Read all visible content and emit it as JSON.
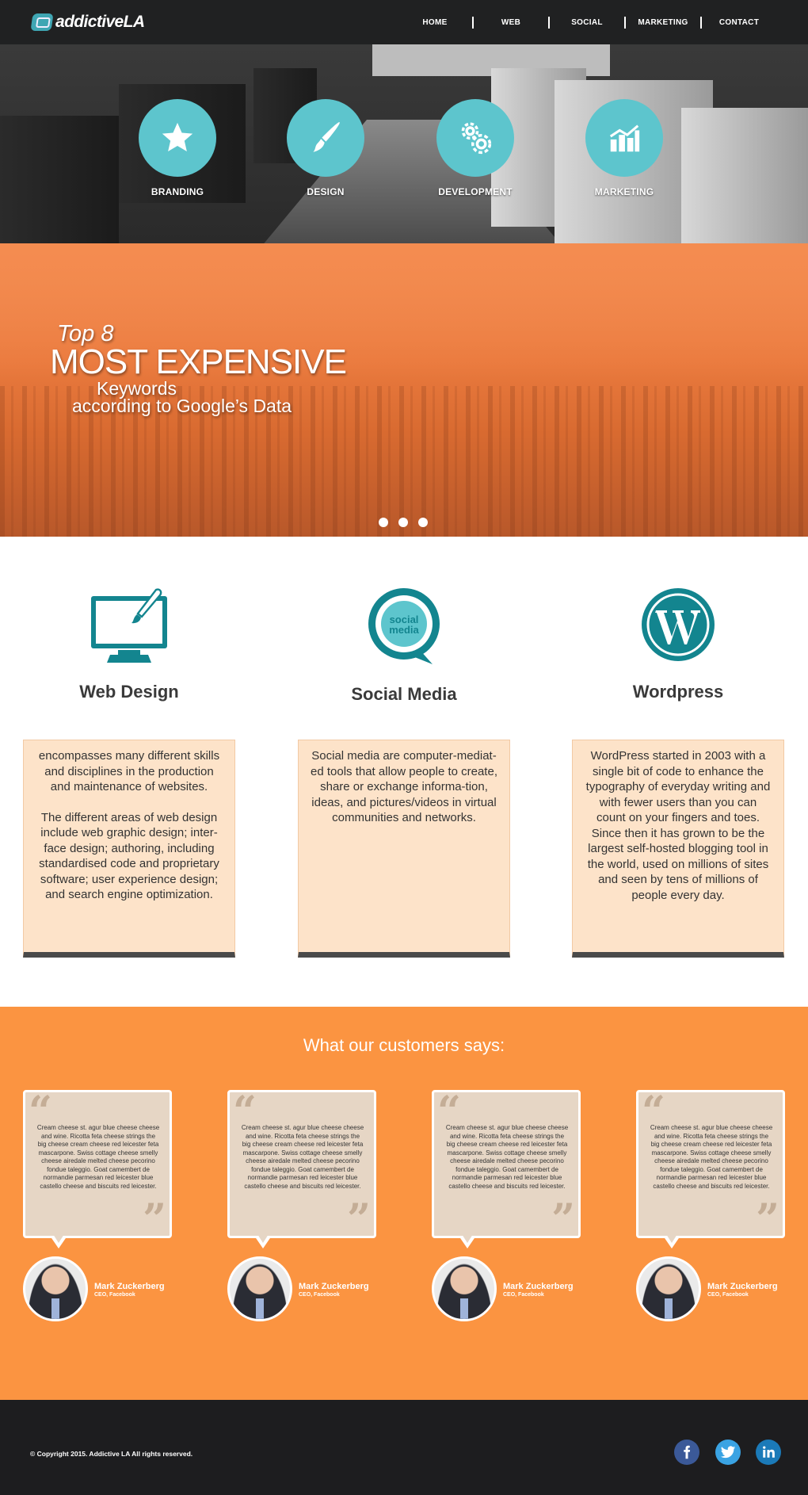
{
  "header": {
    "logo_text": "addictiveLA",
    "nav": [
      "HOME",
      "WEB",
      "SOCIAL",
      "MARKETING",
      "CONTACT"
    ]
  },
  "hero": {
    "services": [
      {
        "label": "BRANDING",
        "icon": "star-icon"
      },
      {
        "label": "DESIGN",
        "icon": "paintbrush-icon"
      },
      {
        "label": "DEVELOPMENT",
        "icon": "gears-icon"
      },
      {
        "label": "MARKETING",
        "icon": "chart-icon"
      }
    ]
  },
  "slider": {
    "line1": "Top 8",
    "line2": "MOST EXPENSIVE",
    "line3": "Keywords",
    "line4": "according to Google’s Data",
    "dots": 3
  },
  "features": [
    {
      "title": "Web Design",
      "icon": "monitor-brush-icon",
      "paragraphs": [
        "encompasses many different skills and disciplines in the production and maintenance of websites.",
        "The different areas of web design include web graphic design; inter-face design; authoring, including standardised code and proprietary software; user experience design; and search engine optimization."
      ]
    },
    {
      "title": "Social Media",
      "icon": "social-media-bubble-icon",
      "icon_text_1": "social",
      "icon_text_2": "media",
      "paragraphs": [
        "Social media are computer-mediat-ed tools that allow people to create, share or exchange informa-tion, ideas, and pictures/videos in virtual communities and networks."
      ]
    },
    {
      "title": "Wordpress",
      "icon": "wordpress-icon",
      "paragraphs": [
        "WordPress started in 2003 with a single bit of code to enhance the typography of everyday writing and with fewer users than you can count on your fingers and toes. Since then it has grown to be the largest self-hosted blogging tool in the world, used on millions of sites and seen by tens of millions of people every day."
      ]
    }
  ],
  "testimonials": {
    "heading": "What our customers says:",
    "items": [
      {
        "quote": "Cream cheese st. agur blue cheese cheese and wine. Ricotta feta cheese strings the big cheese cream cheese red leicester feta mascarpone. Swiss cottage cheese smelly cheese airedale melted cheese pecorino fondue taleggio. Goat camembert de normandie parmesan red leicester blue castello cheese and biscuits red leicester.",
        "name": "Mark Zuckerberg",
        "role": "CEO, Facebook"
      },
      {
        "quote": "Cream cheese st. agur blue cheese cheese and wine. Ricotta feta cheese strings the big cheese cream cheese red leicester feta mascarpone. Swiss cottage cheese smelly cheese airedale melted cheese pecorino fondue taleggio. Goat camembert de normandie parmesan red leicester blue castello cheese and biscuits red leicester.",
        "name": "Mark Zuckerberg",
        "role": "CEO, Facebook"
      },
      {
        "quote": "Cream cheese st. agur blue cheese cheese and wine. Ricotta feta cheese strings the big cheese cream cheese red leicester feta mascarpone. Swiss cottage cheese smelly cheese airedale melted cheese pecorino fondue taleggio. Goat camembert de normandie parmesan red leicester blue castello cheese and biscuits red leicester.",
        "name": "Mark Zuckerberg",
        "role": "CEO, Facebook"
      },
      {
        "quote": "Cream cheese st. agur blue cheese cheese and wine. Ricotta feta cheese strings the big cheese cream cheese red leicester feta mascarpone. Swiss cottage cheese smelly cheese airedale melted cheese pecorino fondue taleggio. Goat camembert de normandie parmesan red leicester blue castello cheese and biscuits red leicester.",
        "name": "Mark Zuckerberg",
        "role": "CEO, Facebook"
      }
    ]
  },
  "footer": {
    "copyright": "© Copyright 2015.  Addictive LA All rights reserved.",
    "social": [
      {
        "name": "facebook-icon",
        "glyph": "f",
        "color": "#3b5998"
      },
      {
        "name": "twitter-icon",
        "glyph": "t",
        "color": "#3aa3e3"
      },
      {
        "name": "linkedin-icon",
        "glyph": "in",
        "color": "#1b7ab8"
      }
    ]
  },
  "colors": {
    "teal": "#5dc5cd",
    "dark_teal": "#13858f",
    "orange": "#fb9441",
    "slider_orange": "#ea7a3e",
    "box_bg": "#fde3c9",
    "header_bg": "#202122"
  }
}
